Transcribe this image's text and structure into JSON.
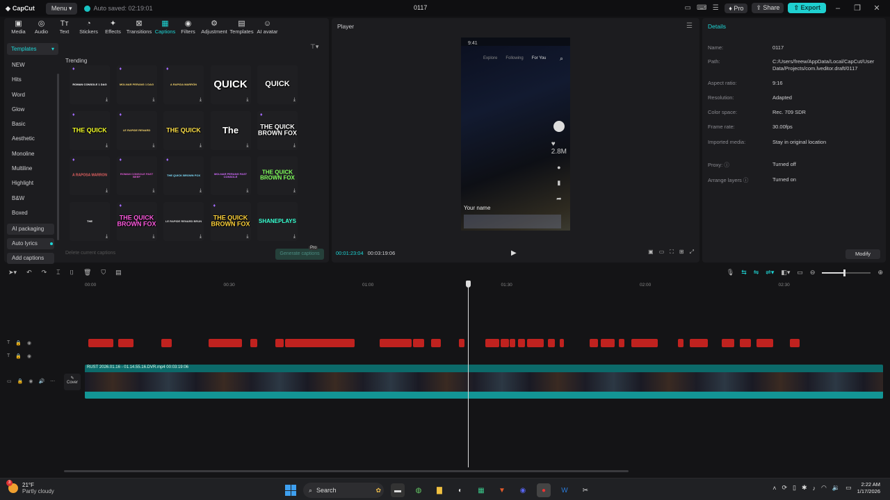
{
  "titlebar": {
    "logo": "CapCut",
    "menu": "Menu",
    "autosave": "Auto saved: 02:19:01",
    "project": "0117",
    "pro": "Pro",
    "share": "Share",
    "export": "Export"
  },
  "toolbar": [
    "Media",
    "Audio",
    "Text",
    "Stickers",
    "Effects",
    "Transitions",
    "Captions",
    "Filters",
    "Adjustment",
    "Templates",
    "AI avatar"
  ],
  "toolbar_icons": [
    "media-icon",
    "audio-icon",
    "text-icon",
    "stickers-icon",
    "effects-icon",
    "transitions-icon",
    "captions-icon",
    "filters-icon",
    "adjustment-icon",
    "templates-icon",
    "ai-avatar-icon"
  ],
  "captions_panel": {
    "dropdown": "Templates",
    "categories": [
      "NEW",
      "Hits",
      "Word",
      "Glow",
      "Basic",
      "Aesthetic",
      "Monoline",
      "Multiline",
      "Highlight",
      "B&W",
      "Boxed"
    ],
    "ai_packaging": "AI packaging",
    "auto_lyrics": "Auto lyrics",
    "add_captions": "Add captions",
    "section": "Trending",
    "delete_captions": "Delete current captions",
    "generate": "Generate captions",
    "pro_tag": "Pro",
    "cards": [
      {
        "text": "ROMAN CONSOLE 1 DAG",
        "color": "#ffffff",
        "size": 4,
        "gem": true
      },
      {
        "text": "MOLNAR PERANG 1 DAG",
        "color": "#f3d36b",
        "size": 4,
        "gem": true
      },
      {
        "text": "A RAPIDA MARRÓN",
        "color": "#f3d36b",
        "size": 4,
        "gem": true
      },
      {
        "text": "QUICK",
        "color": "#ffffff",
        "size": 15,
        "gem": false
      },
      {
        "text": "QUICK",
        "color": "#ffffff",
        "size": 11,
        "gem": false
      },
      {
        "text": "THE QUICK",
        "color": "#f5ff2a",
        "size": 9,
        "gem": true
      },
      {
        "text": "LE RAPIDE RENARD",
        "color": "#f3d36b",
        "size": 4,
        "gem": true
      },
      {
        "text": "THE QUICK",
        "color": "#ffe14a",
        "size": 9,
        "gem": false
      },
      {
        "text": "The",
        "color": "#ffffff",
        "size": 13,
        "gem": false
      },
      {
        "text": "THE QUICK BROWN FOX",
        "color": "#ffffff",
        "size": 9,
        "gem": true
      },
      {
        "text": "A RAPOSA MARRON",
        "color": "#e06060",
        "size": 5,
        "gem": true
      },
      {
        "text": "ROMAN CONSOLE FAST BEEF",
        "color": "#e05ad6",
        "size": 4,
        "gem": true
      },
      {
        "text": "THE QUICK BROWN FOX",
        "color": "#7fe0ff",
        "size": 4,
        "gem": true
      },
      {
        "text": "MOLNAR PERANG FAST CONSOLE",
        "color": "#d26bff",
        "size": 4,
        "gem": false
      },
      {
        "text": "THE QUICK BROWN FOX",
        "color": "#7fff5a",
        "size": 8,
        "gem": false
      },
      {
        "text": "THE",
        "color": "#ffffff",
        "size": 4,
        "gem": false
      },
      {
        "text": "THE QUICK BROWN FOX",
        "color": "#ff5ae0",
        "size": 9,
        "gem": true
      },
      {
        "text": "LE RAPIDE RENARD BRUN",
        "color": "#dddddd",
        "size": 4,
        "gem": false
      },
      {
        "text": "THE QUICK BROWN FOX",
        "color": "#ffd23a",
        "size": 9,
        "gem": true
      },
      {
        "text": "SHANEPLAYS",
        "color": "#34ffd0",
        "size": 8,
        "gem": false
      }
    ]
  },
  "player": {
    "title": "Player",
    "current_time": "00:01:23:04",
    "total_time": "00:03:19:06",
    "video": {
      "status_time": "9:41",
      "tabs": [
        "Explore",
        "Following",
        "For You"
      ],
      "username": "Your name",
      "likes": "2.8M"
    }
  },
  "details": {
    "title": "Details",
    "rows": [
      {
        "label": "Name:",
        "value": "0117"
      },
      {
        "label": "Path:",
        "value": "C:/Users/freew/AppData/Local/CapCut/User Data/Projects/com.lveditor.draft/0117"
      },
      {
        "label": "Aspect ratio:",
        "value": "9:16"
      },
      {
        "label": "Resolution:",
        "value": "Adapted"
      },
      {
        "label": "Color space:",
        "value": "Rec. 709 SDR"
      },
      {
        "label": "Frame rate:",
        "value": "30.00fps"
      },
      {
        "label": "Imported media:",
        "value": "Stay in original location"
      },
      {
        "label": "Proxy: ⓘ",
        "value": "Turned off"
      },
      {
        "label": "Arrange layers ⓘ",
        "value": "Turned on"
      }
    ],
    "modify": "Modify"
  },
  "timeline": {
    "ruler": [
      "00:00",
      "00:30",
      "01:00",
      "01:30",
      "02:00",
      "02:30"
    ],
    "video_clip": "RUST 2026.01.16 - 01.14.55.16.DVR.mp4   00:03:19:06",
    "cover": "Cover",
    "zoom_level": 0.45
  },
  "taskbar": {
    "temp": "21°F",
    "weather": "Partly cloudy",
    "badge": "3",
    "search": "Search",
    "time": "2:22 AM",
    "date": "1/17/2026"
  }
}
